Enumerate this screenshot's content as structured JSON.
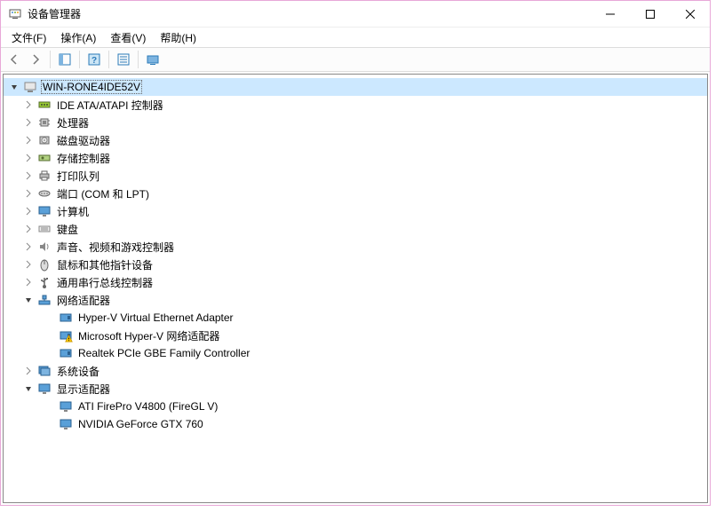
{
  "window": {
    "title": "设备管理器"
  },
  "menu": {
    "file": "文件(F)",
    "action": "操作(A)",
    "view": "查看(V)",
    "help": "帮助(H)"
  },
  "tree": {
    "root": "WIN-RONE4IDE52V",
    "categories": [
      {
        "label": "IDE ATA/ATAPI 控制器",
        "expanded": false,
        "children": []
      },
      {
        "label": "处理器",
        "expanded": false,
        "children": []
      },
      {
        "label": "磁盘驱动器",
        "expanded": false,
        "children": []
      },
      {
        "label": "存储控制器",
        "expanded": false,
        "children": []
      },
      {
        "label": "打印队列",
        "expanded": false,
        "children": []
      },
      {
        "label": "端口 (COM 和 LPT)",
        "expanded": false,
        "children": []
      },
      {
        "label": "计算机",
        "expanded": false,
        "children": []
      },
      {
        "label": "键盘",
        "expanded": false,
        "children": []
      },
      {
        "label": "声音、视频和游戏控制器",
        "expanded": false,
        "children": []
      },
      {
        "label": "鼠标和其他指针设备",
        "expanded": false,
        "children": []
      },
      {
        "label": "通用串行总线控制器",
        "expanded": false,
        "children": []
      },
      {
        "label": "网络适配器",
        "expanded": true,
        "children": [
          {
            "label": "Hyper-V Virtual Ethernet Adapter",
            "warning": false
          },
          {
            "label": "Microsoft Hyper-V 网络适配器",
            "warning": true
          },
          {
            "label": "Realtek PCIe GBE Family Controller",
            "warning": false
          }
        ]
      },
      {
        "label": "系统设备",
        "expanded": false,
        "children": []
      },
      {
        "label": "显示适配器",
        "expanded": true,
        "children": [
          {
            "label": "ATI FirePro V4800 (FireGL V)",
            "warning": false
          },
          {
            "label": "NVIDIA GeForce GTX 760",
            "warning": false
          }
        ]
      }
    ]
  },
  "icons": {
    "ide": "ide",
    "cpu": "cpu",
    "disk": "disk",
    "storage": "storage",
    "printer": "printer",
    "port": "port",
    "computer": "computer",
    "keyboard": "keyboard",
    "sound": "sound",
    "mouse": "mouse",
    "usb": "usb",
    "network": "network",
    "system": "system",
    "display": "display",
    "netadapter": "netadapter",
    "monitor": "monitor"
  }
}
